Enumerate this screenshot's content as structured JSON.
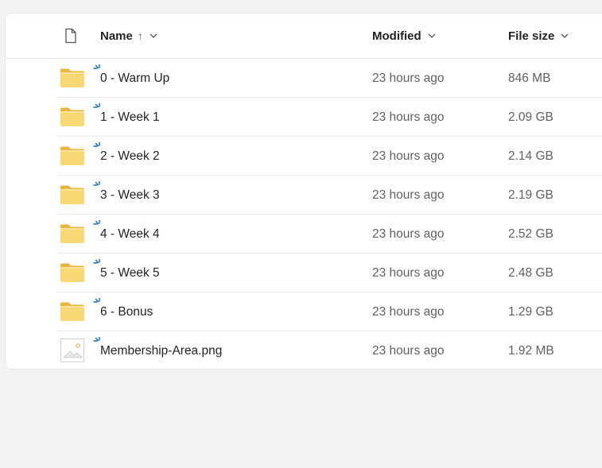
{
  "header": {
    "name_label": "Name",
    "name_sort": "↑",
    "modified_label": "Modified",
    "size_label": "File size"
  },
  "colors": {
    "folder": "#f8d775",
    "folder_dark": "#e9b63c",
    "sync": "#0f6cbd"
  },
  "rows": [
    {
      "name": "0 - Warm Up",
      "modified": "23 hours ago",
      "size": "846 MB",
      "icon": "folder-icon"
    },
    {
      "name": "1 - Week 1",
      "modified": "23 hours ago",
      "size": "2.09 GB",
      "icon": "folder-icon"
    },
    {
      "name": "2 - Week 2",
      "modified": "23 hours ago",
      "size": "2.14 GB",
      "icon": "folder-icon"
    },
    {
      "name": "3 - Week 3",
      "modified": "23 hours ago",
      "size": "2.19 GB",
      "icon": "folder-icon"
    },
    {
      "name": "4 - Week 4",
      "modified": "23 hours ago",
      "size": "2.52 GB",
      "icon": "folder-icon"
    },
    {
      "name": "5 - Week 5",
      "modified": "23 hours ago",
      "size": "2.48 GB",
      "icon": "folder-icon"
    },
    {
      "name": "6 - Bonus",
      "modified": "23 hours ago",
      "size": "1.29 GB",
      "icon": "folder-icon"
    },
    {
      "name": "Membership-Area.png",
      "modified": "23 hours ago",
      "size": "1.92 MB",
      "icon": "image-file-icon"
    }
  ]
}
